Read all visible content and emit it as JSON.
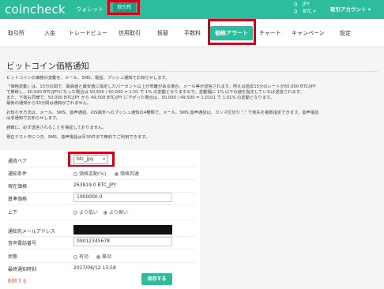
{
  "header": {
    "logo": "coincheck",
    "nav_wallet": "ウォレット",
    "nav_exchange": "取引所",
    "balance_jpy": "0",
    "balance_jpy_unit": "JPY",
    "balance_btc": "0",
    "balance_btc_unit": "BTC",
    "balance_caret": "▾",
    "account_label": "取引アカウント",
    "account_caret": "▾"
  },
  "tabs": [
    {
      "label": "取引所"
    },
    {
      "label": "入金"
    },
    {
      "label": "トレードビュー"
    },
    {
      "label": "信用取引"
    },
    {
      "label": "板替"
    },
    {
      "label": "手数料"
    },
    {
      "label": "価格アラート"
    },
    {
      "label": "チャート"
    },
    {
      "label": "キャンペーン"
    },
    {
      "label": "設定"
    }
  ],
  "page": {
    "title": "ビットコイン価格通知",
    "intro": "ビットコインの価格の変動を、メール、SMS、電話、プッシュ通知でお知らせします。",
    "p1_l1": "「価格変動」は、15分の間で、最高値と最安値に指定したパーセント以上が乖離がある場合、メール等が送信されます。例えば過去15分のレートが50,000 BTC/JPY",
    "p1_l2": "で推移し、50,500 BTC/JPYになった場合は 50,500 / 50,000 = 1.01 で 1% の変動となりますので、変動幅に 1% 以下の値を指定していれば送信されます。",
    "p1_l3": "また、下落も同様で、50,000 BTC/JPY から 49,500 BTC/JPY に下がった場合は、50,000 / 49,500 = 1.0101 で 1.01% の変動となります。",
    "p1_l4": "最後の通知から30分間は通知がされません。",
    "p2_l1": "お知らせ方法は、メール、SMS、音声通話、iOS端末へのプッシュ通知の4種類で、メール、SMS,音声通話は、カンマ区切り \",\" で宛先を複数指定できます。音声電話",
    "p2_l2": "は非通知でお知らせします。",
    "p3": "誤報に、必ず送信されることを保証しておりません。",
    "p4": "現在テスト中につき、SMS、音声電話は月30件まで無料でご利用できます。"
  },
  "form": {
    "pair_label": "通貨ペア",
    "pair_value": "btc_jpy",
    "pair_caret": "▾",
    "condition_label": "通知条件",
    "condition_opt1": "価格変動(%)",
    "condition_opt2": "価格到達",
    "current_label": "現在価格",
    "current_value": "263819.0 BTC_JPY",
    "base_label": "基準価格",
    "base_value": "1000000.0",
    "direction_label": "上下",
    "direction_opt1": "より低い",
    "direction_opt2": "より高い",
    "email_label": "通知先メールアドレス",
    "phone_label": "音声電話番号",
    "phone_value": "09012345678",
    "status_label": "状態",
    "status_opt1": "有効",
    "status_opt2": "無効",
    "last_label": "最終通知時刻",
    "last_value": "2017/06/12 13:58",
    "delete_label": "削除する",
    "save_label": "保存する"
  }
}
